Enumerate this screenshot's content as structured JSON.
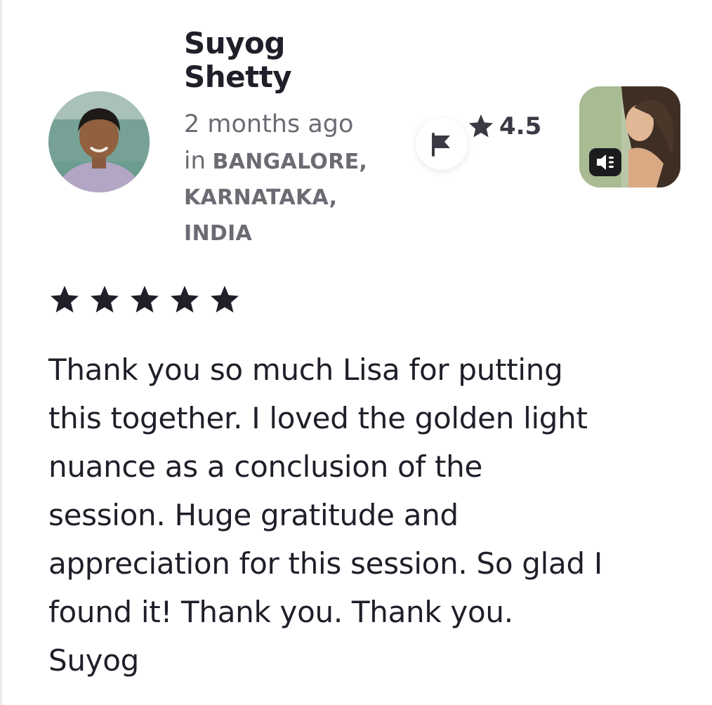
{
  "reviewer": {
    "name": "Suyog Shetty",
    "time_ago": "2 months ago",
    "location_prefix": "in",
    "location": "BANGALORE, KARNATAKA, INDIA",
    "avatar_icon": "person-avatar-photo"
  },
  "session": {
    "rating": "4.5",
    "thumbnail_icon": "session-thumbnail-photo",
    "audio_icon": "audio-speaker-icon"
  },
  "actions": {
    "flag_icon": "flag-icon"
  },
  "review": {
    "stars": 5,
    "text": "Thank you so much Lisa for putting this together. I loved the golden light nuance as a conclusion of the session. Huge gratitude and appreciation for this session. So glad I found it! Thank you. Thank you. Suyog"
  },
  "colors": {
    "text": "#1f1f29",
    "muted": "#6b6b73",
    "star": "#1f1f29"
  }
}
